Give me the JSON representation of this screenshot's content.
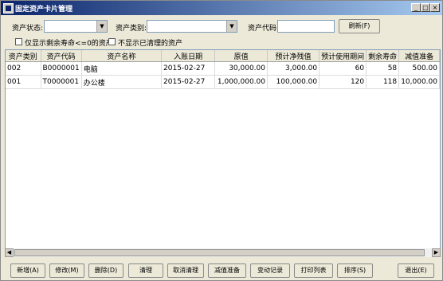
{
  "window": {
    "title": "固定资产卡片管理",
    "controls": {
      "minimize": "_",
      "maximize": "□",
      "close": "×"
    }
  },
  "filters": {
    "status_label": "资产状态:",
    "status_value": "",
    "category_label": "资产类别:",
    "category_value": "",
    "code_label": "资产代码:",
    "code_value": "",
    "refresh_label": "刷新(F)",
    "check_remaining_label": "仅显示剩余寿命<=0的资产",
    "check_hide_cleared_label": "不显示已清理的资产"
  },
  "table": {
    "columns": [
      "资产类别",
      "资产代码",
      "资产名称",
      "入账日期",
      "原值",
      "预计净残值",
      "预计使用期间",
      "剩余寿命",
      "减值准备"
    ],
    "rows": [
      [
        "002",
        "B0000001",
        "电脑",
        "2015-02-27",
        "30,000.00",
        "3,000.00",
        "60",
        "58",
        "500.00"
      ],
      [
        "001",
        "T0000001",
        "办公楼",
        "2015-02-27",
        "1,000,000.00",
        "100,000.00",
        "120",
        "118",
        "10,000.00"
      ]
    ]
  },
  "buttons": {
    "add": "新增(A)",
    "edit": "修改(M)",
    "delete": "删除(D)",
    "clear": "清理",
    "cancel_clear": "取消清理",
    "impairment": "减值准备",
    "change_log": "变动记录",
    "print_list": "打印列表",
    "sort": "排序(S)",
    "exit": "退出(E)"
  }
}
